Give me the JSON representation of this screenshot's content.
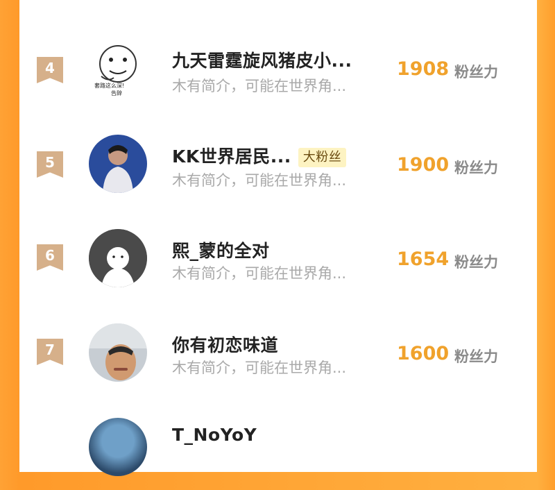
{
  "rows": [
    {
      "rank": "4",
      "name": "九天雷霆旋风猪皮小...",
      "badge": "",
      "bio": "木有简介，可能在世界角...",
      "count": "1908",
      "unit": "粉丝力",
      "avatar_icon": "meme-face-icon",
      "avatar_text_1": "套路这么深!",
      "avatar_text_2": "告辞"
    },
    {
      "rank": "5",
      "name": "KK世界居民...",
      "badge": "大粉丝",
      "bio": "木有简介，可能在世界角...",
      "count": "1900",
      "unit": "粉丝力",
      "avatar_icon": "person-photo-icon"
    },
    {
      "rank": "6",
      "name": "熙_蒙的全对",
      "badge": "",
      "bio": "木有简介，可能在世界角...",
      "count": "1654",
      "unit": "粉丝力",
      "avatar_icon": "default-avatar-icon"
    },
    {
      "rank": "7",
      "name": "你有初恋味道",
      "badge": "",
      "bio": "木有简介，可能在世界角...",
      "count": "1600",
      "unit": "粉丝力",
      "avatar_icon": "selfie-photo-icon"
    },
    {
      "rank": "",
      "name": "T_NoYoY",
      "badge": "",
      "bio": "",
      "count": "",
      "unit": "",
      "avatar_icon": "photo-avatar-icon"
    }
  ]
}
